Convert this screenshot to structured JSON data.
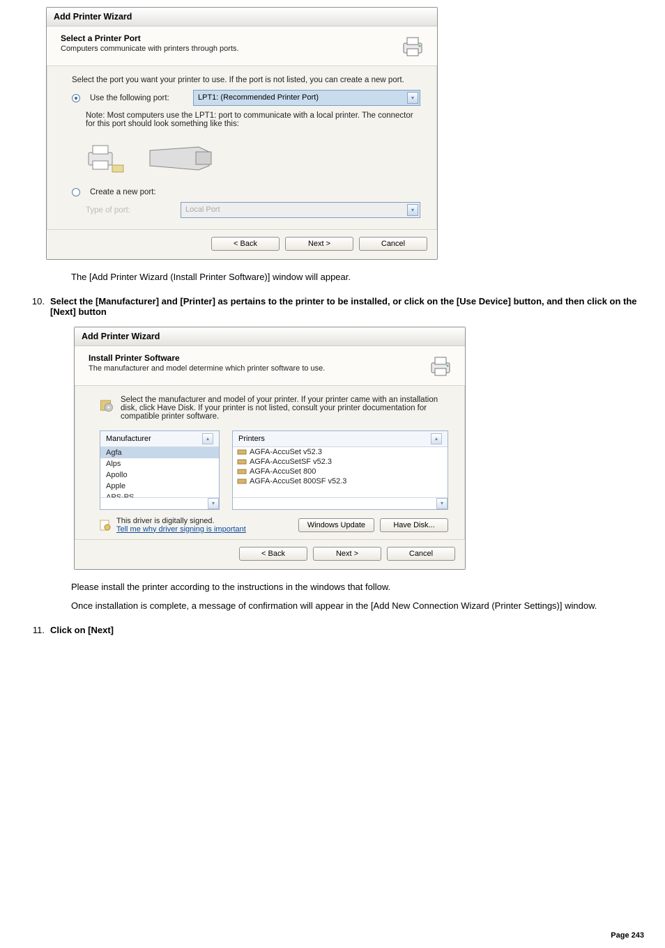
{
  "dialog1": {
    "window_title": "Add Printer Wizard",
    "header_title": "Select a Printer Port",
    "header_sub": "Computers communicate with printers through ports.",
    "intro": "Select the port you want your printer to use.  If the port is not listed, you can create a new port.",
    "use_port_label": "Use the following port:",
    "use_port_value": "LPT1: (Recommended Printer Port)",
    "note": "Note: Most computers use the LPT1: port to communicate with a local printer. The connector for this port should look something like this:",
    "create_port_label": "Create a new port:",
    "type_of_port_label": "Type of port:",
    "type_of_port_value": "Local Port",
    "back": "< Back",
    "next": "Next >",
    "cancel": "Cancel"
  },
  "paragraph_after_d1": "The [Add Printer Wizard (Install Printer Software)] window will appear.",
  "step10": {
    "num": "10.",
    "text": "Select the [Manufacturer] and [Printer] as pertains to the printer to be installed, or click on the [Use Device] button, and then click on the [Next] button"
  },
  "dialog2": {
    "window_title": "Add Printer Wizard",
    "header_title": "Install Printer Software",
    "header_sub": "The manufacturer and model determine which printer software to use.",
    "intro": "Select the manufacturer and model of your printer. If your printer came with an installation disk, click Have Disk. If your printer is not listed, consult your printer documentation for compatible printer software.",
    "mfg_header": "Manufacturer",
    "printers_header": "Printers",
    "manufacturers": [
      "Agfa",
      "Alps",
      "Apollo",
      "Apple",
      "APS-PS"
    ],
    "mfg_selected_index": 0,
    "printers": [
      "AGFA-AccuSet v52.3",
      "AGFA-AccuSetSF v52.3",
      "AGFA-AccuSet 800",
      "AGFA-AccuSet 800SF v52.3"
    ],
    "signed_text": "This driver is digitally signed.",
    "signed_link": "Tell me why driver signing is important",
    "windows_update": "Windows Update",
    "have_disk": "Have Disk...",
    "back": "< Back",
    "next": "Next >",
    "cancel": "Cancel"
  },
  "paragraph_after_d2a": "Please install the printer according to the instructions in the windows that follow.",
  "paragraph_after_d2b": "Once installation is complete, a message of confirmation will appear in the [Add New Connection Wizard (Printer Settings)] window.",
  "step11": {
    "num": "11.",
    "text": "Click on [Next]"
  },
  "page_footer": "Page 243"
}
